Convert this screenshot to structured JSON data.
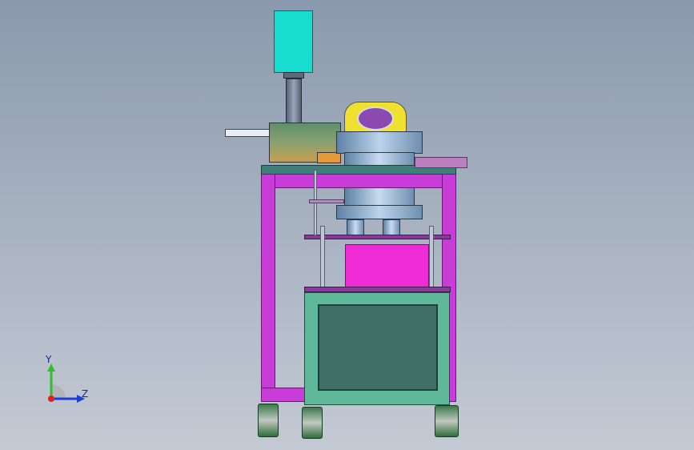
{
  "triad": {
    "y_label": "Y",
    "z_label": "Z",
    "colors": {
      "y": "#2fbf2f",
      "z": "#1d3fd6",
      "x": "#e02020"
    }
  },
  "model": {
    "colors": {
      "motor_cap": "#16ddd0",
      "frame": "#c83cd8",
      "cabinet": "#5fb89a",
      "cabinet_panel": "#3f6f66",
      "drum": "#8fb6d6",
      "bowl": "#f0e030",
      "feet": "#2f6f3a"
    }
  }
}
